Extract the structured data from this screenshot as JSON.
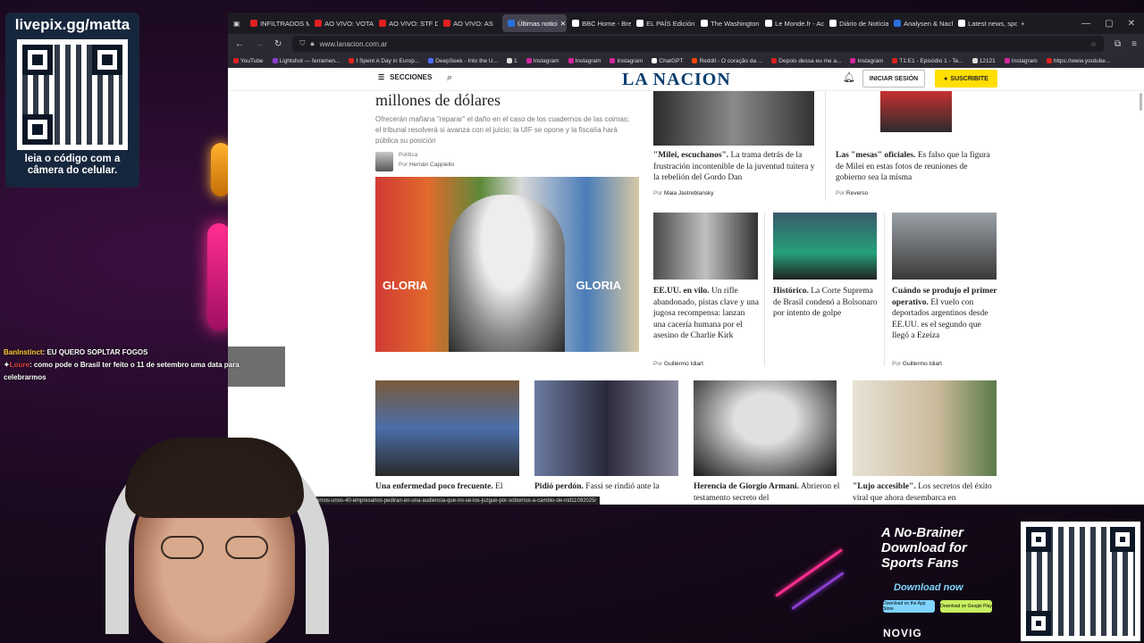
{
  "stream": {
    "qr_title": "livepix.gg/matta",
    "qr_caption": "leia o código com a câmera do celular."
  },
  "browser": {
    "tabs": [
      {
        "label": "INFILTRADOS M",
        "color": "#e02020"
      },
      {
        "label": "AO VIVO: VOTAÇ",
        "color": "#e02020"
      },
      {
        "label": "AO VIVO: STF DE",
        "color": "#e02020"
      },
      {
        "label": "AO VIVO: AS",
        "color": "#e02020"
      },
      {
        "label": "Últimas notici",
        "color": "#2a6fdb",
        "active": true
      },
      {
        "label": "BBC Home - Brea",
        "color": "#ffffff"
      },
      {
        "label": "EL PAÍS Edición A",
        "color": "#ffffff"
      },
      {
        "label": "The Washington",
        "color": "#ffffff"
      },
      {
        "label": "Le Monde.fr - Ac",
        "color": "#ffffff"
      },
      {
        "label": "Diário de Notícias",
        "color": "#ffffff"
      },
      {
        "label": "Analysen & Nach",
        "color": "#2a6fdb"
      },
      {
        "label": "Latest news, spo",
        "color": "#ffffff"
      }
    ],
    "url": "www.lanacion.com.ar",
    "bookmarks": [
      {
        "label": "YouTube",
        "color": "#e02020"
      },
      {
        "label": "Lightshot — ferramen...",
        "color": "#8a3dd1"
      },
      {
        "label": "I Spent A Day in Europ...",
        "color": "#e02020"
      },
      {
        "label": "DeepSeek - Into the U...",
        "color": "#4d6bfe"
      },
      {
        "label": "1",
        "color": "#dddddd"
      },
      {
        "label": "Instagram",
        "color": "#d6249f"
      },
      {
        "label": "Instagram",
        "color": "#d6249f"
      },
      {
        "label": "Instagram",
        "color": "#d6249f"
      },
      {
        "label": "ChatGPT",
        "color": "#ffffff"
      },
      {
        "label": "Reddit - O coração da ...",
        "color": "#ff4500"
      },
      {
        "label": "Depois dessa eu me a...",
        "color": "#e02020"
      },
      {
        "label": "Instagram",
        "color": "#d6249f"
      },
      {
        "label": "T1:E1 - Episódio 1 - Te...",
        "color": "#e02020"
      },
      {
        "label": "12121",
        "color": "#dddddd"
      },
      {
        "label": "Instagram",
        "color": "#d6249f"
      },
      {
        "label": "https://www.youtube...",
        "color": "#e02020"
      }
    ],
    "status_url": "olitica/cuadernos-unos-40-empresarios-pediran-en-una-audiencia-que-no-se-los-juzgue-por-sobornos-a-cambio-de-nid11092025/"
  },
  "site": {
    "secciones": "SECCIONES",
    "logo": "LA NACION",
    "login": "INICIAR SESIÓN",
    "subscribe": "SUSCRIBITE",
    "main": {
      "headline": "millones de dólares",
      "lead": "Ofrecerán mañana \"reparar\" el daño en el caso de los cuadernos de las coimas; el tribunal resolverá si avanza con el juicio; la UIF se opone y la fiscalía hará pública su posición",
      "section": "Política",
      "byline_prefix": "Por",
      "author": "Hernán Cappiello",
      "image_text_left": "GLORIA",
      "image_text_right": "GLORIA"
    },
    "cards": [
      {
        "kicker": "\"Milei, escuchanos\".",
        "text": "La trama detrás de la frustración incontenible de la juventud tuitera y la rebelión del Gordo Dan",
        "author": "Maia Jastreblansky"
      },
      {
        "kicker": "Las \"mesas\" oficiales.",
        "text": "Es falso que la figura de Milei en estas fotos de reuniones de gobierno sea la misma",
        "author": "Reverso"
      },
      {
        "kicker": "EE.UU. en vilo.",
        "text": "Un rifle abandonado, pistas clave y una jugosa recompensa: lanzan una cacería humana por el asesino de Charlie Kirk",
        "author": "Guillermo Idiart"
      },
      {
        "kicker": "Histórico.",
        "text": "La Corte Suprema de Brasil condenó a Bolsonaro por intento de golpe",
        "author": ""
      },
      {
        "kicker": "Cuándo se produjo el primer operativo.",
        "text": "El vuelo con deportados argentinos desde EE.UU. es el segundo que llegó a Ezeiza",
        "author": "Guillermo Idiart"
      },
      {
        "kicker": "Una enfermedad poco frecuente.",
        "text": "El",
        "author": ""
      },
      {
        "kicker": "Pidió perdón.",
        "text": "Fassi se rindió ante la",
        "author": ""
      },
      {
        "kicker": "Herencia de Giorgio Armani.",
        "text": "Abrieron el testamento secreto del",
        "author": ""
      },
      {
        "kicker": "\"Lujo accesible\".",
        "text": "Los secretos del éxito viral que ahora desembarca en",
        "author": ""
      }
    ]
  },
  "chat": [
    {
      "user": "BanInstinct",
      "message": ": EU QUERO SOPLTAR FOGOS"
    },
    {
      "user": "Loure",
      "message": ": como pode o Brasil ter feito o 11 de setembro uma data para celebrarmos"
    }
  ],
  "ad": {
    "title": "A No-Brainer Download for Sports Fans",
    "cta": "Download now",
    "app_store": "Download on the App Store",
    "google_play": "Download on Google Play",
    "brand": "NOVIG"
  }
}
